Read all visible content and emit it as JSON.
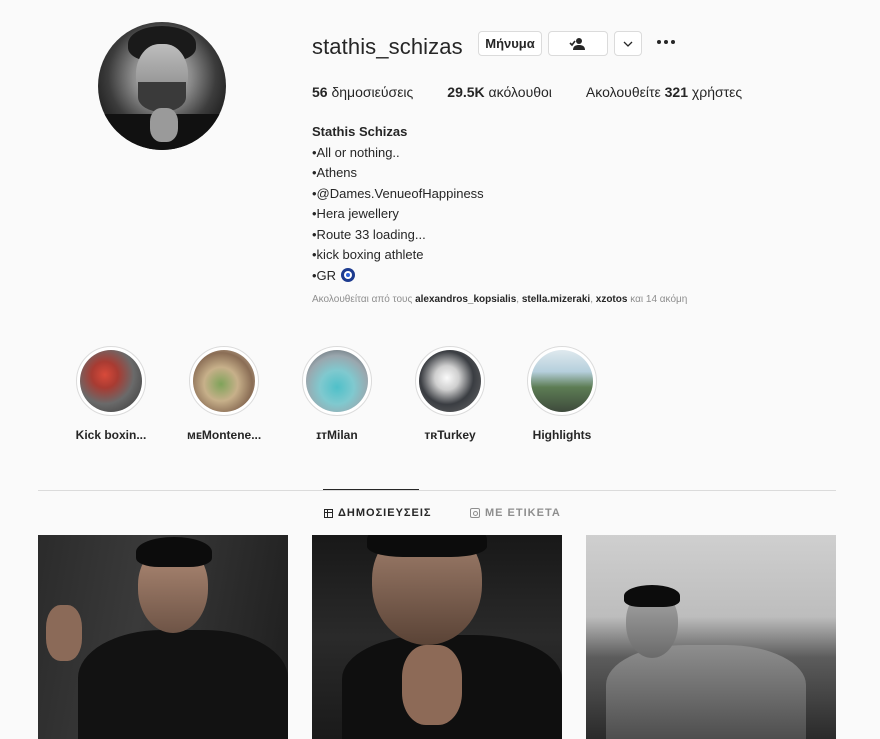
{
  "profile": {
    "username": "stathis_schizas",
    "buttons": {
      "message": "Μήνυμα",
      "follow_icon": "person-check-icon",
      "chevron_icon": "chevron-down-icon",
      "more_icon": "more-horizontal-icon"
    },
    "stats": {
      "posts_count": "56",
      "posts_label": "δημοσιεύσεις",
      "followers_count": "29.5K",
      "followers_label": "ακόλουθοι",
      "following_prefix": "Ακολουθείτε",
      "following_count": "321",
      "following_label": "χρήστες"
    },
    "bio": {
      "name": "Stathis Schizas",
      "lines": [
        "•All or nothing..",
        "•Athens",
        "•@Dames.VenueofHappiness",
        "•Hera jewellery",
        "•Route 33 loading...",
        "•kick boxing athlete",
        "•GR"
      ],
      "last_line_icon": "nazar-eye-icon"
    },
    "followed_by": {
      "prefix": "Ακολουθείται από τους",
      "user1": "alexandros_kopsialis",
      "sep1": ",",
      "user2": "stella.mizeraki",
      "sep2": ",",
      "user3": "xzotos",
      "suffix": "και 14 ακόμη"
    }
  },
  "highlights": [
    {
      "label": "Kick boxin..."
    },
    {
      "label": "ᴍᴇMontene..."
    },
    {
      "label": "ɪᴛMilan"
    },
    {
      "label": "ᴛʀTurkey"
    },
    {
      "label": "Highlights"
    }
  ],
  "tabs": {
    "posts": "ΔΗΜΟΣΙΕΥΣΕΙΣ",
    "tagged": "ΜΕ ΕΤΙΚΕΤΑ",
    "active": "posts"
  },
  "colors": {
    "background": "#fafafa",
    "text": "#262626",
    "muted": "#8e8e8e",
    "border": "#dbdbdb"
  }
}
